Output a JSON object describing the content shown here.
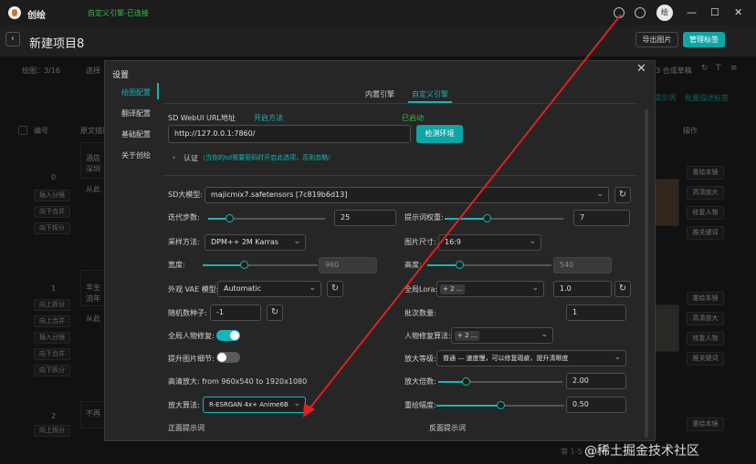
{
  "titlebar": {
    "app_name": "创绘",
    "connection_status": "自定义引擎-已连接",
    "avatar_text": "绘",
    "icons": [
      "gear-icon",
      "help-icon",
      "minimize-icon",
      "maximize-icon",
      "close-icon"
    ]
  },
  "header": {
    "project_title": "新建项目8",
    "export_button": "导出图片",
    "manage_tags_button": "管理标签",
    "drawing_count": "绘图：3/16",
    "select_label": "选择",
    "compose_label": "3 合成草稿"
  },
  "background": {
    "col_number": "编号",
    "col_desc": "原文描述",
    "col_ops": "操作",
    "right_link1": "批量提示词",
    "right_link2": "批量描述标签",
    "rows": [
      {
        "index": "0",
        "text1": "酒店",
        "text2": "深圳",
        "text3": "从此",
        "buttons": [
          "插入分镜",
          "向下合并",
          "向下拆分"
        ]
      },
      {
        "index": "1",
        "text1": "羊生",
        "text2": "流年",
        "text3": "从此",
        "buttons": [
          "向上拆分",
          "向上合并",
          "插入分镜",
          "向下合并",
          "向下拆分"
        ]
      },
      {
        "index": "2",
        "text1": "不再",
        "text2": "",
        "text3": "",
        "buttons": [
          "向上拆分"
        ]
      }
    ],
    "right_buttons": [
      "重绘本镜",
      "高清放大",
      "修复人物",
      "推关键词"
    ],
    "footer": "第 1-5 条/总共"
  },
  "dialog": {
    "title": "设置",
    "sidebar": [
      "绘图配置",
      "翻译配置",
      "基础配置",
      "关于创绘"
    ],
    "tabs": [
      "内置引擎",
      "自定义引擎"
    ],
    "webui_label": "SD WebUI URL地址",
    "open_method_link": "开启方法",
    "started_text": "已启动",
    "url_value": "http://127.0.0.1:7860/",
    "check_env_button": "检测环境",
    "auth_label": "认证",
    "auth_hint": "（当你的sd需要密码时开启此选项，否则忽略）",
    "model_label": "SD大模型:",
    "model_value": "majicmix7.safetensors [7c819b6d13]",
    "steps_label": "迭代步数:",
    "steps_value": "25",
    "steps_fraction": 0.18,
    "prompt_weight_label": "提示词权重:",
    "prompt_weight_value": "7",
    "prompt_weight_fraction": 0.35,
    "sampler_label": "采样方法:",
    "sampler_value": "DPM++ 2M Karras",
    "size_label": "图片尺寸:",
    "size_value": "16:9",
    "width_label": "宽度:",
    "width_value": "960",
    "width_fraction": 0.36,
    "height_label": "高度:",
    "height_value": "540",
    "height_fraction": 0.26,
    "vae_label": "外观 VAE 模型:",
    "vae_value": "Automatic",
    "lora_label": "全局Lora:",
    "lora_tag": "+ 2 ...",
    "lora_value": "1.0",
    "seed_label": "随机数种子:",
    "seed_value": "-1",
    "batch_label": "批次数量:",
    "batch_value": "1",
    "face_fix_label": "全局人物修复:",
    "face_fix_on": true,
    "face_algo_label": "人物修复算法:",
    "face_algo_tag": "+ 2 ...",
    "detail_label": "提升图片细节:",
    "detail_on": false,
    "upscale_level_label": "放大等级:",
    "upscale_level_value": "普通 — 速度慢，可以修复瑕疵，提升清晰度",
    "hires_text": "高清放大: from 960x540 to 1920x1080",
    "upscale_factor_label": "放大倍数:",
    "upscale_factor_value": "2.00",
    "upscale_factor_fraction": 0.22,
    "upscale_algo_label": "放大算法:",
    "upscale_algo_value": "R-ESRGAN 4x+ Anime6B",
    "redraw_label": "重绘幅度:",
    "redraw_value": "0.50",
    "redraw_fraction": 0.5,
    "positive_prompt_label": "正面提示词",
    "negative_prompt_label": "反面提示词"
  },
  "watermark": "@稀土掘金技术社区",
  "colors": {
    "accent": "#17b6b6",
    "status_green": "#2fbf52",
    "arrow": "#e02020"
  }
}
